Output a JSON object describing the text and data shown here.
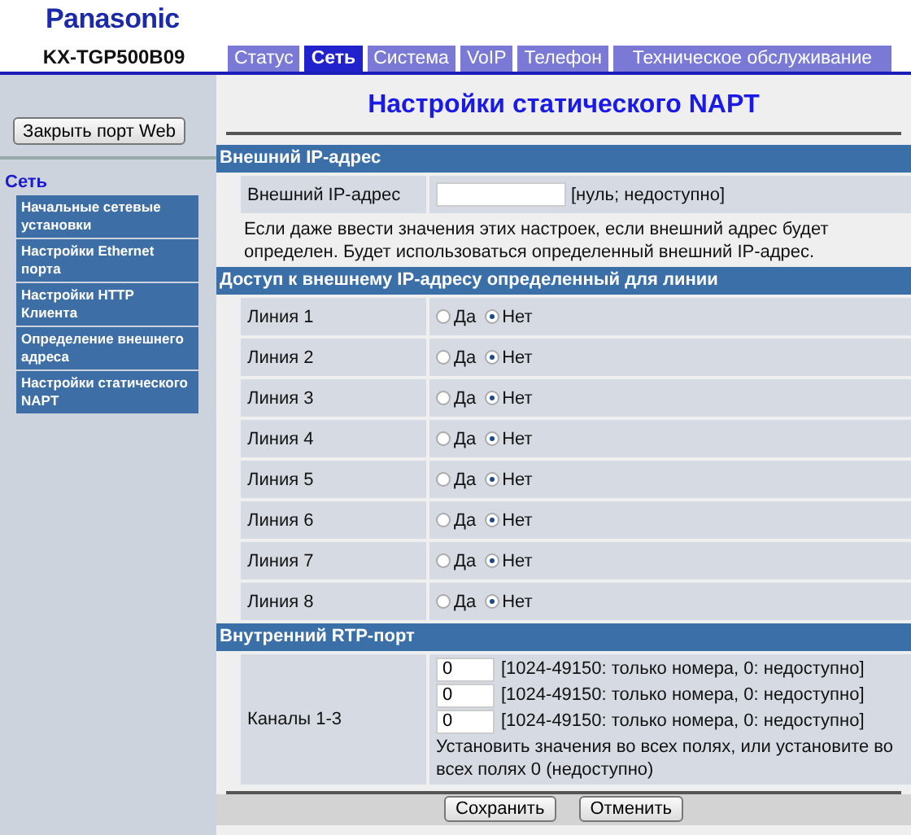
{
  "brand": "Panasonic",
  "model": "KX-TGP500B09",
  "tabs": [
    {
      "label": "Статус",
      "selected": false
    },
    {
      "label": "Сеть",
      "selected": true
    },
    {
      "label": "Система",
      "selected": false
    },
    {
      "label": "VoIP",
      "selected": false
    },
    {
      "label": "Телефон",
      "selected": false
    },
    {
      "label": "Техническое обслуживание",
      "selected": false
    }
  ],
  "sidebar": {
    "close_button": "Закрыть порт Web",
    "heading": "Сеть",
    "items": [
      {
        "label": "Начальные сетевые установки"
      },
      {
        "label": "Настройки Ethernet порта"
      },
      {
        "label": "Настройки HTTP Клиента"
      },
      {
        "label": "Определение внешнего адреса"
      },
      {
        "label": "Настройки статического NAPT"
      }
    ]
  },
  "page_title": "Настройки статического NAPT",
  "external_ip": {
    "header": "Внешний IP-адрес",
    "label": "Внешний IP-адрес",
    "hint": "[нуль; недоступно]",
    "note": "Если даже ввести значения этих настроек, если внешний адрес будет определен. Будет использоваться определенный внешний IP-адрес."
  },
  "line_access": {
    "header": "Доступ к внешнему IP-адресу определенный для линии",
    "lines": [
      {
        "label": "Линия 1",
        "options": [
          {
            "label": "Да",
            "selected": false
          },
          {
            "label": "Нет",
            "selected": true
          }
        ]
      },
      {
        "label": "Линия 2",
        "options": [
          {
            "label": "Да",
            "selected": false
          },
          {
            "label": "Нет",
            "selected": true
          }
        ]
      },
      {
        "label": "Линия 3",
        "options": [
          {
            "label": "Да",
            "selected": false
          },
          {
            "label": "Нет",
            "selected": true
          }
        ]
      },
      {
        "label": "Линия 4",
        "options": [
          {
            "label": "Да",
            "selected": false
          },
          {
            "label": "Нет",
            "selected": true
          }
        ]
      },
      {
        "label": "Линия 5",
        "options": [
          {
            "label": "Да",
            "selected": false
          },
          {
            "label": "Нет",
            "selected": true
          }
        ]
      },
      {
        "label": "Линия 6",
        "options": [
          {
            "label": "Да",
            "selected": false
          },
          {
            "label": "Нет",
            "selected": true
          }
        ]
      },
      {
        "label": "Линия 7",
        "options": [
          {
            "label": "Да",
            "selected": false
          },
          {
            "label": "Нет",
            "selected": true
          }
        ]
      },
      {
        "label": "Линия 8",
        "options": [
          {
            "label": "Да",
            "selected": false
          },
          {
            "label": "Нет",
            "selected": true
          }
        ]
      }
    ]
  },
  "rtp": {
    "header": "Внутренний RTP-порт",
    "label": "Каналы 1-3",
    "fields": [
      {
        "value": "0",
        "hint": "[1024-49150: только номера, 0: недоступно]"
      },
      {
        "value": "0",
        "hint": "[1024-49150: только номера, 0: недоступно]"
      },
      {
        "value": "0",
        "hint": "[1024-49150: только номера, 0: недоступно]"
      }
    ],
    "note": "Установить значения во всех полях, или установите во всех полях 0 (недоступно)"
  },
  "buttons": [
    "Сохранить",
    "Отменить"
  ]
}
